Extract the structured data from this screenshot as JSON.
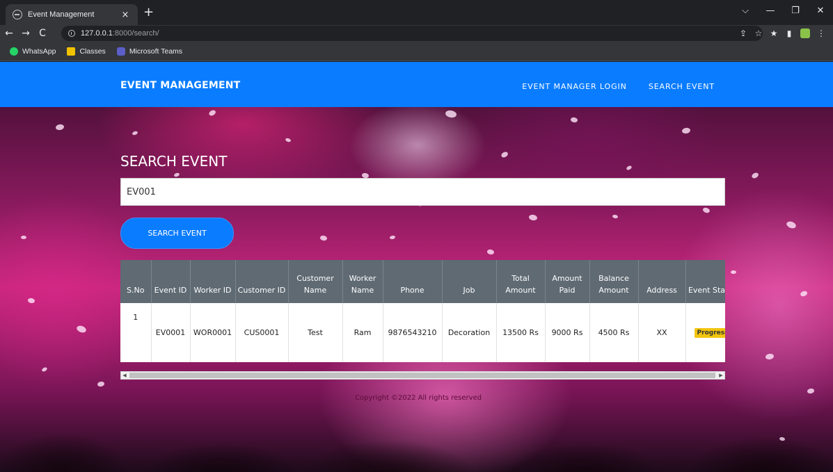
{
  "browser": {
    "tab_title": "Event Management",
    "tab_close": "×",
    "new_tab": "+",
    "url_host": "127.0.0.1",
    "url_path": ":8000/search/",
    "controls": {
      "back": "←",
      "forward": "→",
      "reload": "C"
    },
    "window": {
      "dropdown": "⌵",
      "minimize": "—",
      "maximize": "❐",
      "close": "✕"
    },
    "toolbar_icons": {
      "share": "⇪",
      "star": "☆",
      "extensions": "★",
      "sidepanel": "▮",
      "menu": "⋮"
    },
    "bookmarks": [
      {
        "label": "WhatsApp",
        "icon": "whatsapp-icon"
      },
      {
        "label": "Classes",
        "icon": "classes-icon"
      },
      {
        "label": "Microsoft Teams",
        "icon": "teams-icon"
      }
    ]
  },
  "header": {
    "brand": "EVENT MANAGEMENT",
    "nav": [
      "EVENT MANAGER LOGIN",
      "SEARCH EVENT"
    ],
    "color": "#0a7cff"
  },
  "search": {
    "title": "SEARCH EVENT",
    "value": "EV001",
    "button_label": "SEARCH EVENT"
  },
  "table": {
    "columns": [
      "S.No",
      "Event ID",
      "Worker ID",
      "Customer ID",
      "Customer Name",
      "Worker Name",
      "Phone",
      "Job",
      "Total Amount",
      "Amount Paid",
      "Balance Amount",
      "Address",
      "Event Status"
    ],
    "rows": [
      {
        "sno": "1",
        "event_id": "EV0001",
        "worker_id": "WOR0001",
        "customer_id": "CUS0001",
        "customer_name": "Test",
        "worker_name": "Ram",
        "phone": "9876543210",
        "job": "Decoration",
        "total_amount": "13500 Rs",
        "amount_paid": "9000 Rs",
        "balance_amount": "4500 Rs",
        "address": "XX",
        "event_status": "Progress"
      }
    ],
    "badge_color": "#f1c40f"
  },
  "scrollbar": {
    "left_arrow": "◀",
    "right_arrow": "▶"
  },
  "footer": {
    "copyright": "Copyright ©2022 All rights reserved"
  }
}
